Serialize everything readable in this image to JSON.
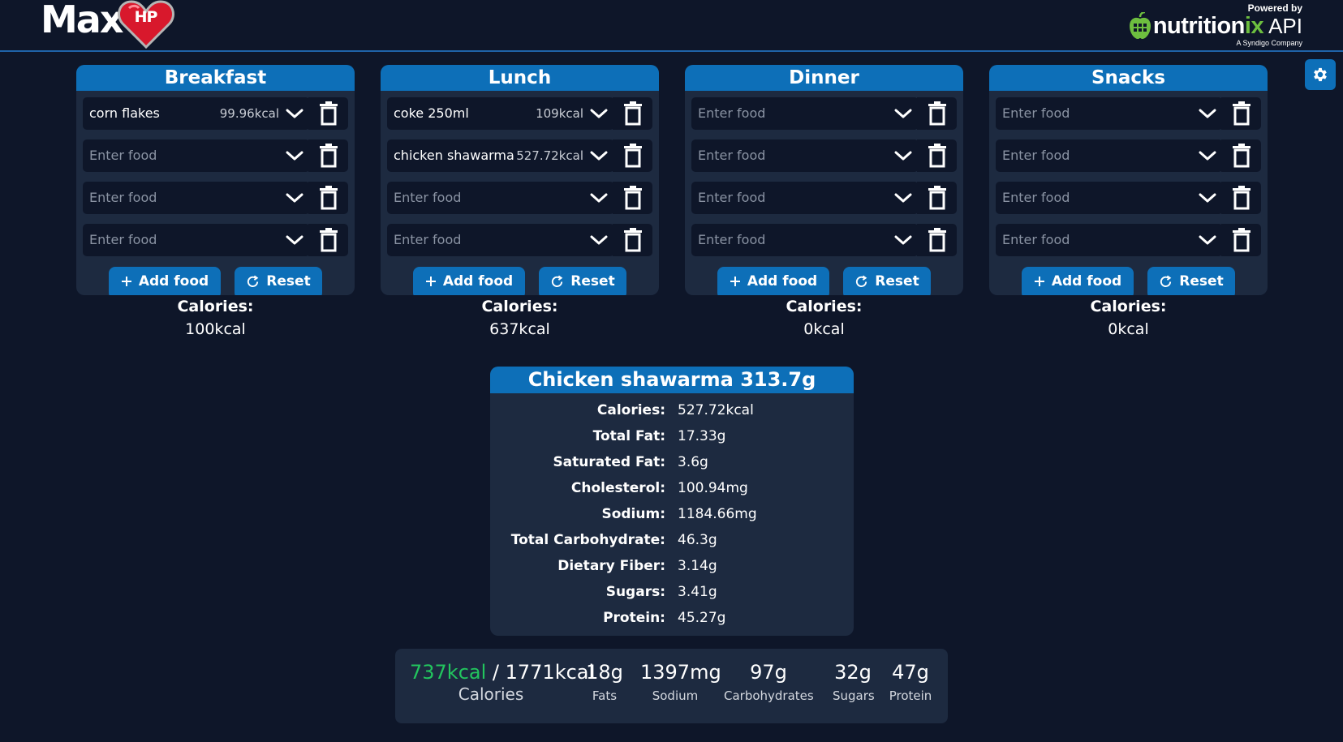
{
  "brand": {
    "logo_text": "Max",
    "logo_badge": "HP",
    "powered_by": "Powered by",
    "api_name_a": "nutrition",
    "api_name_b": "ix",
    "api_suffix": "API",
    "api_sub": "A Syndigo Company"
  },
  "settings": {
    "icon": "gear-icon"
  },
  "meals": [
    {
      "title": "Breakfast",
      "items": [
        {
          "name": "corn flakes",
          "kcal": "99.96kcal"
        },
        {
          "name": "Enter food",
          "kcal": ""
        },
        {
          "name": "Enter food",
          "kcal": ""
        },
        {
          "name": "Enter food",
          "kcal": ""
        }
      ],
      "add_label": "Add food",
      "reset_label": "Reset",
      "calories_label": "Calories:",
      "calories_value": "100kcal"
    },
    {
      "title": "Lunch",
      "items": [
        {
          "name": "coke 250ml",
          "kcal": "109kcal"
        },
        {
          "name": "chicken shawarma",
          "kcal": "527.72kcal"
        },
        {
          "name": "Enter food",
          "kcal": ""
        },
        {
          "name": "Enter food",
          "kcal": ""
        }
      ],
      "add_label": "Add food",
      "reset_label": "Reset",
      "calories_label": "Calories:",
      "calories_value": "637kcal"
    },
    {
      "title": "Dinner",
      "items": [
        {
          "name": "Enter food",
          "kcal": ""
        },
        {
          "name": "Enter food",
          "kcal": ""
        },
        {
          "name": "Enter food",
          "kcal": ""
        },
        {
          "name": "Enter food",
          "kcal": ""
        }
      ],
      "add_label": "Add food",
      "reset_label": "Reset",
      "calories_label": "Calories:",
      "calories_value": "0kcal"
    },
    {
      "title": "Snacks",
      "items": [
        {
          "name": "Enter food",
          "kcal": ""
        },
        {
          "name": "Enter food",
          "kcal": ""
        },
        {
          "name": "Enter food",
          "kcal": ""
        },
        {
          "name": "Enter food",
          "kcal": ""
        }
      ],
      "add_label": "Add food",
      "reset_label": "Reset",
      "calories_label": "Calories:",
      "calories_value": "0kcal"
    }
  ],
  "detail": {
    "title": "Chicken shawarma 313.7g",
    "rows": [
      {
        "label": "Calories:",
        "value": "527.72kcal"
      },
      {
        "label": "Total Fat:",
        "value": "17.33g"
      },
      {
        "label": "Saturated Fat:",
        "value": "3.6g"
      },
      {
        "label": "Cholesterol:",
        "value": "100.94mg"
      },
      {
        "label": "Sodium:",
        "value": "1184.66mg"
      },
      {
        "label": "Total Carbohydrate:",
        "value": "46.3g"
      },
      {
        "label": "Dietary Fiber:",
        "value": "3.14g"
      },
      {
        "label": "Sugars:",
        "value": "3.41g"
      },
      {
        "label": "Protein:",
        "value": "45.27g"
      }
    ]
  },
  "summary": {
    "calories_consumed": "737kcal",
    "calories_goal": " / 1771kcal",
    "calories_label": "Calories",
    "fats_value": "18g",
    "fats_label": "Fats",
    "sodium_value": "1397mg",
    "sodium_label": "Sodium",
    "carbs_value": "97g",
    "carbs_label": "Carbohydrates",
    "sugars_value": "32g",
    "sugars_label": "Sugars",
    "protein_value": "47g",
    "protein_label": "Protein"
  },
  "colors": {
    "background": "#0e1629",
    "panel": "#1d2a40",
    "accent": "#0d6fb8",
    "consumed": "#22c55e"
  }
}
